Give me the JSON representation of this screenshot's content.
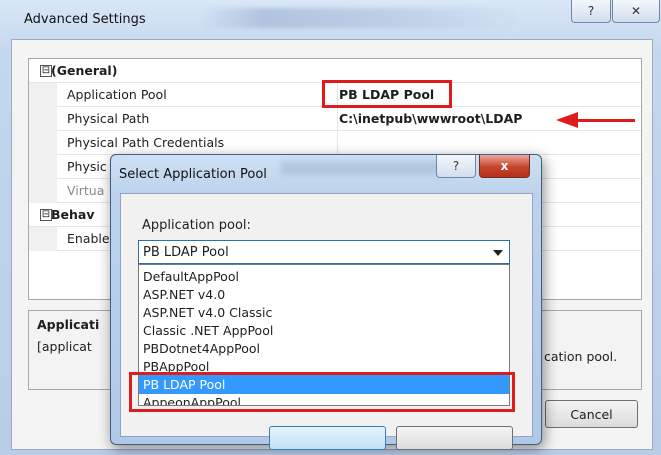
{
  "outer_window": {
    "title": "Advanced Settings",
    "help_label": "?",
    "close_label": "✕"
  },
  "property_grid": {
    "general_category": "(General)",
    "behavior_category": "Behav",
    "expand_glyph": "⊟",
    "rows": [
      {
        "name": "Application Pool",
        "value": "PB LDAP Pool"
      },
      {
        "name": "Physical Path",
        "value": "C:\\inetpub\\wwwroot\\LDAP"
      },
      {
        "name": "Physical Path Credentials",
        "value": ""
      },
      {
        "name": "Physic",
        "value": ""
      },
      {
        "name": "Virtua",
        "value": ""
      },
      {
        "name": "Enable",
        "value": ""
      }
    ]
  },
  "description": {
    "title": "Applicati",
    "text_start": "[applicat",
    "text_end": "cation pool."
  },
  "outer_buttons": {
    "cancel_label": "Cancel"
  },
  "modal": {
    "title": "Select Application Pool",
    "help_label": "?",
    "close_label": "x",
    "label": "Application pool:",
    "selected_value": "PB LDAP Pool",
    "options": [
      "DefaultAppPool",
      "ASP.NET v4.0",
      "ASP.NET v4.0 Classic",
      "Classic .NET AppPool",
      "PBDotnet4AppPool",
      "PBAppPool",
      "PB LDAP Pool",
      "AppeonAppPool"
    ],
    "highlighted_option_index": 6
  },
  "colors": {
    "highlight_red": "#e01b1b",
    "selection_blue": "#3399ff"
  }
}
